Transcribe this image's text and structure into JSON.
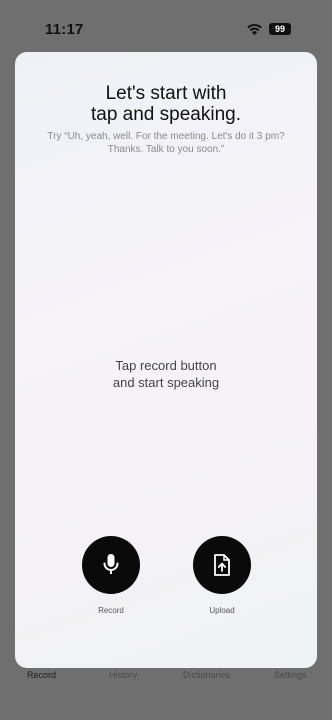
{
  "status_bar": {
    "time": "11:17",
    "battery": "99"
  },
  "modal": {
    "title": "Let's start with\ntap and speaking.",
    "hint": "Try “Uh, yeah, well. For the meeting. Let's do it 3 pm? Thanks. Talk to you soon.”",
    "center_text": "Tap record button\nand start speaking",
    "actions": {
      "record_label": "Record",
      "upload_label": "Upload"
    }
  },
  "tab_bar": {
    "items": [
      {
        "label": "Record",
        "active": true
      },
      {
        "label": "History",
        "active": false
      },
      {
        "label": "Dictionaries",
        "active": false
      },
      {
        "label": "Settings",
        "active": false
      }
    ]
  },
  "colors": {
    "overlay": "#6f6f6f",
    "button": "#0a0a0a",
    "icon": "#ffffff"
  }
}
